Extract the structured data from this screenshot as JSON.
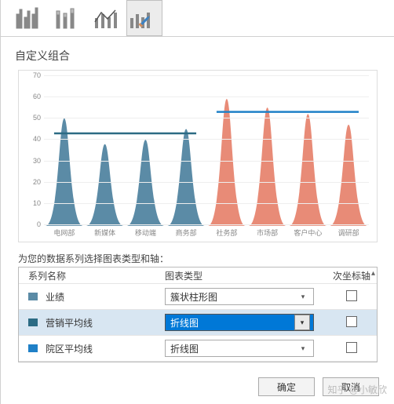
{
  "section_title": "自定义组合",
  "prompt": "为您的数据系列选择图表类型和轴：",
  "headers": {
    "name": "系列名称",
    "type": "图表类型",
    "axis": "次坐标轴"
  },
  "rows": [
    {
      "label": "业绩",
      "color": "#5b8ba6",
      "chart_type": "簇状柱形图",
      "selected": false
    },
    {
      "label": "营销平均线",
      "color": "#2c6b84",
      "chart_type": "折线图",
      "selected": true
    },
    {
      "label": "院区平均线",
      "color": "#1f80c7",
      "chart_type": "折线图",
      "selected": false
    }
  ],
  "footer": {
    "ok": "确定",
    "cancel": "取消"
  },
  "watermark": "知乎 @小敏欣",
  "chart_data": {
    "type": "combo",
    "ylim": [
      0,
      70
    ],
    "yticks": [
      0,
      10,
      20,
      30,
      40,
      50,
      60,
      70
    ],
    "categories": [
      "电网部",
      "新媒体",
      "移动端",
      "商务部",
      "社务部",
      "市场部",
      "客户中心",
      "调研部"
    ],
    "series": [
      {
        "name": "业绩",
        "kind": "peak",
        "colors": [
          "#5b8ba6",
          "#5b8ba6",
          "#5b8ba6",
          "#5b8ba6",
          "#e88b77",
          "#e88b77",
          "#e88b77",
          "#e88b77"
        ],
        "values": [
          50,
          38,
          40,
          45,
          59,
          55,
          52,
          47
        ]
      },
      {
        "name": "营销平均线",
        "kind": "line",
        "color": "#2c6b84",
        "range": [
          0,
          3
        ],
        "value": 43
      },
      {
        "name": "院区平均线",
        "kind": "line",
        "color": "#1f80c7",
        "range": [
          4,
          7
        ],
        "value": 53
      }
    ]
  }
}
